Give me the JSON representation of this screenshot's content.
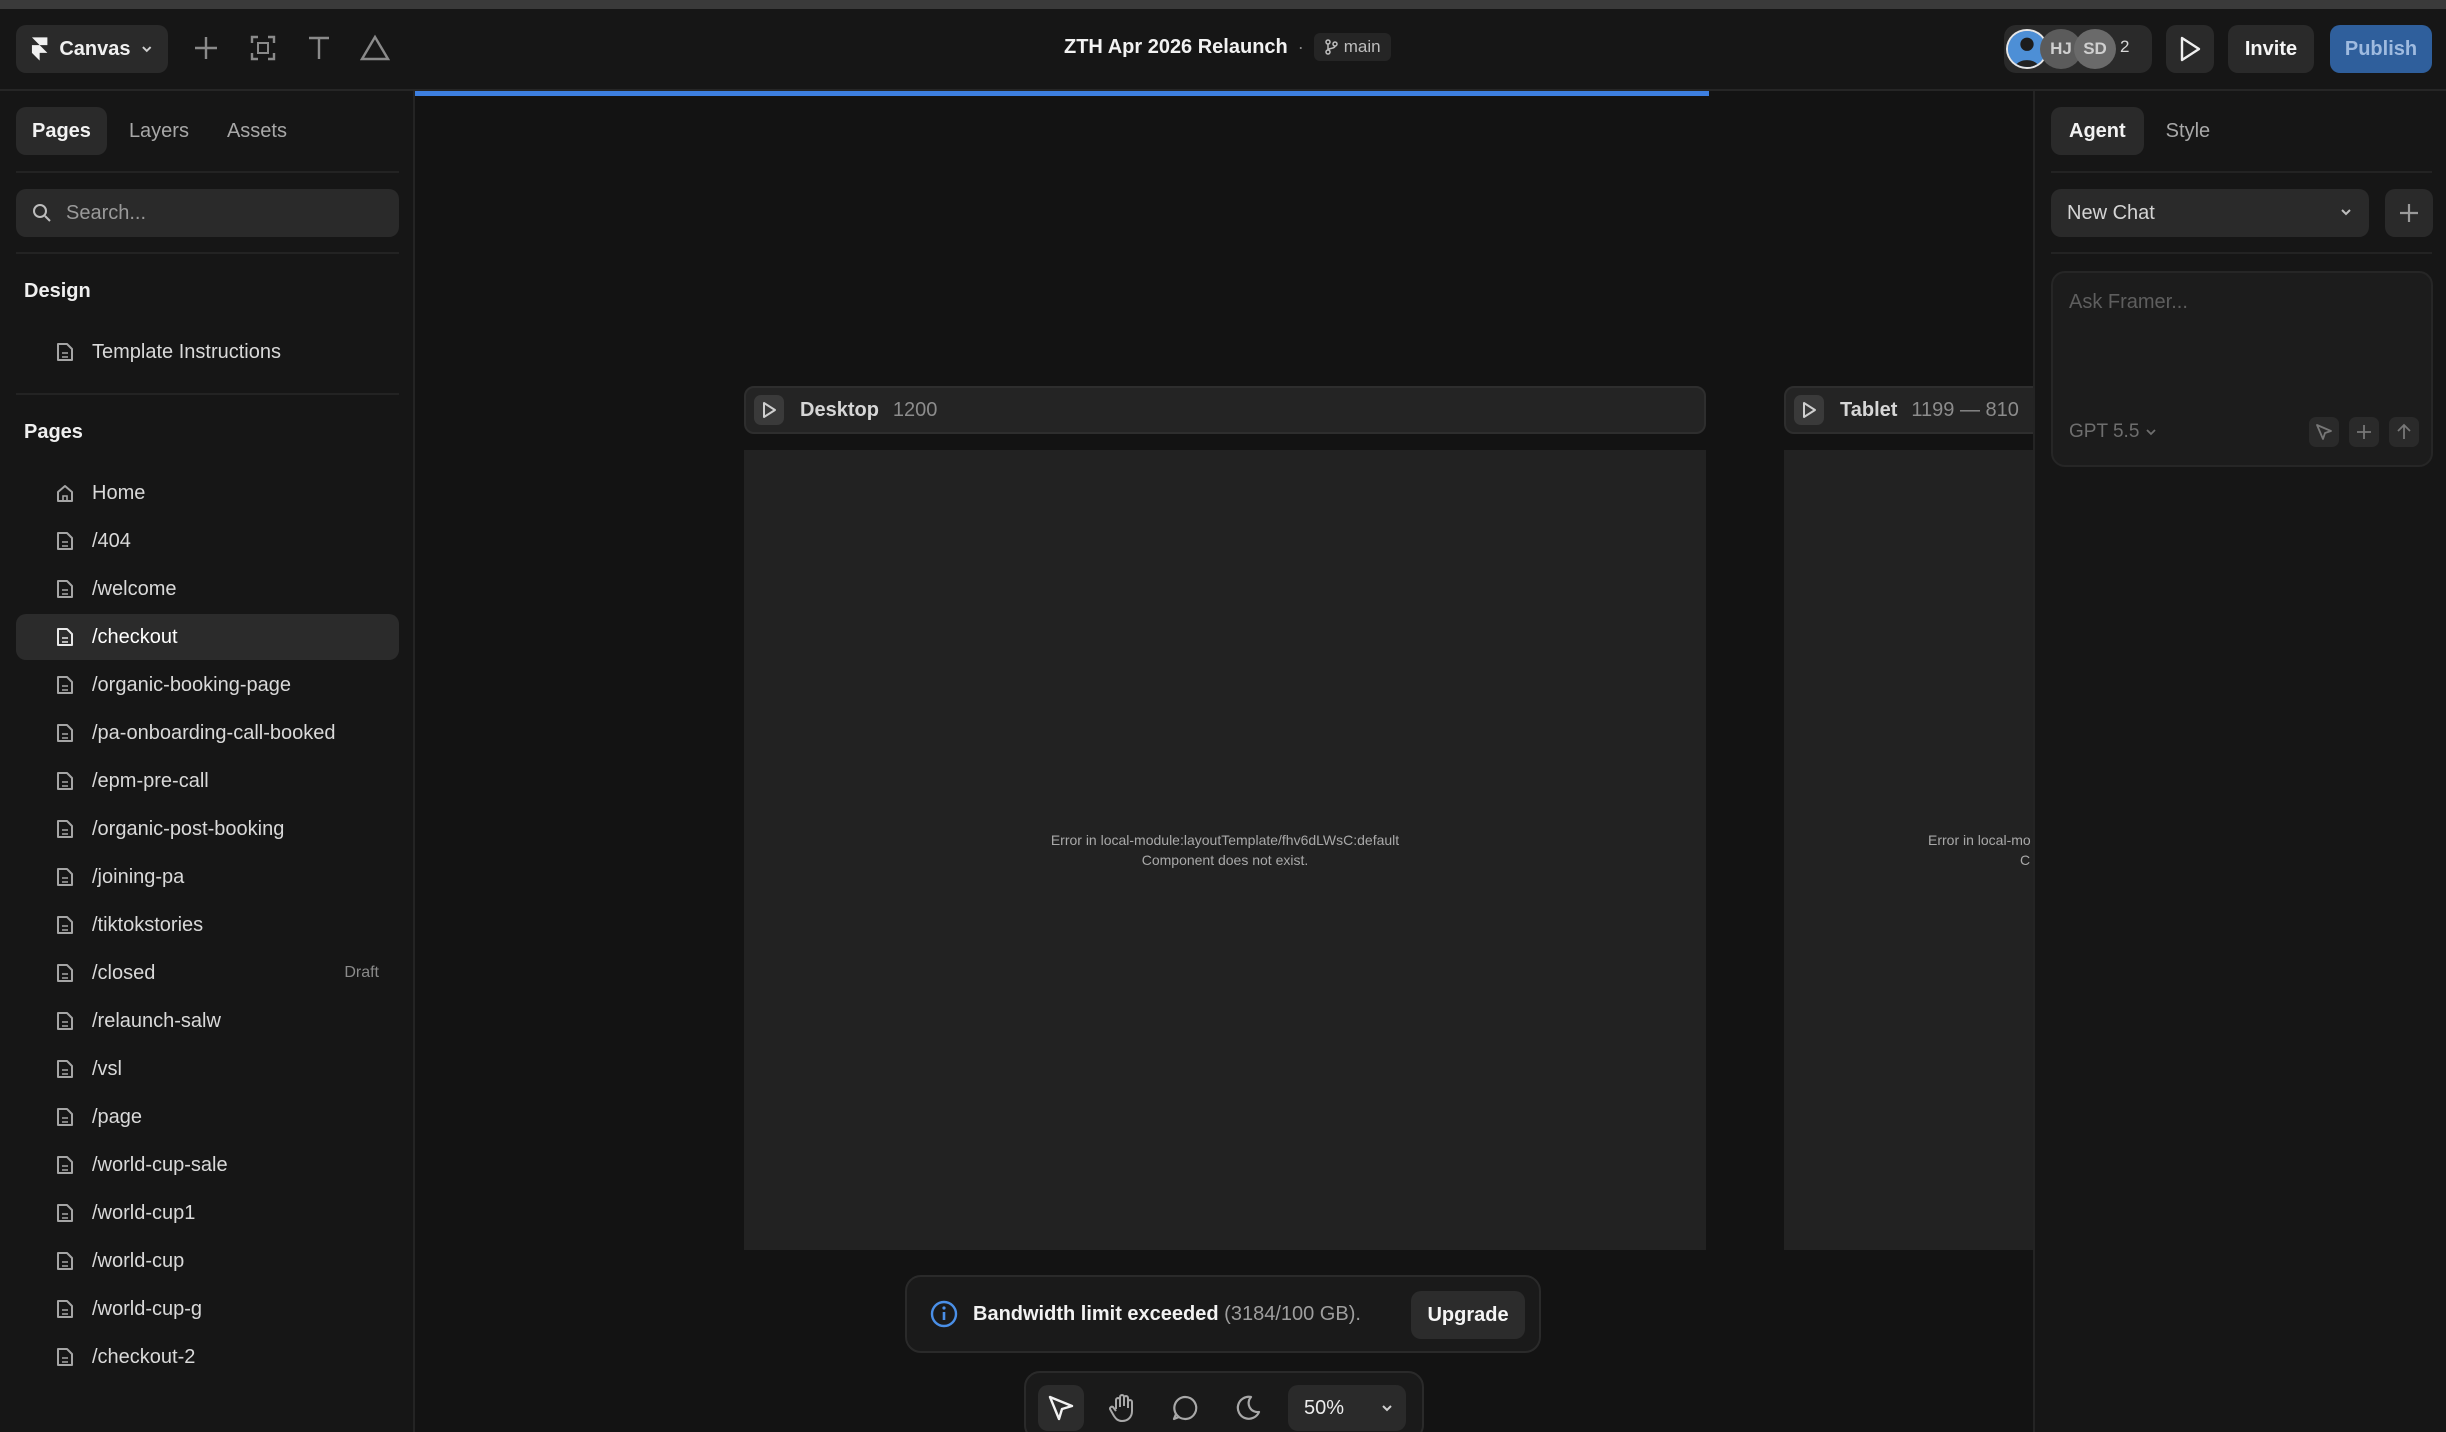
{
  "app": {
    "name": "Canvas"
  },
  "document": {
    "title": "ZTH Apr 2026 Relaunch",
    "separator": "·",
    "branch": "main"
  },
  "collaborators": {
    "initials": [
      "HJ",
      "SD"
    ],
    "count": "2"
  },
  "header": {
    "invite_label": "Invite",
    "publish_label": "Publish"
  },
  "left_panel": {
    "tabs": [
      "Pages",
      "Layers",
      "Assets"
    ],
    "search_placeholder": "Search...",
    "design_section": {
      "title": "Design",
      "items": [
        "Template Instructions"
      ]
    },
    "pages_section": {
      "title": "Pages",
      "items": [
        {
          "label": "Home",
          "icon": "home-icon"
        },
        {
          "label": "/404",
          "icon": "page-icon"
        },
        {
          "label": "/welcome",
          "icon": "page-icon"
        },
        {
          "label": "/checkout",
          "icon": "page-icon",
          "selected": true
        },
        {
          "label": "/organic-booking-page",
          "icon": "page-icon"
        },
        {
          "label": "/pa-onboarding-call-booked",
          "icon": "page-icon"
        },
        {
          "label": "/epm-pre-call",
          "icon": "page-icon"
        },
        {
          "label": "/organic-post-booking",
          "icon": "page-icon"
        },
        {
          "label": "/joining-pa",
          "icon": "page-icon"
        },
        {
          "label": "/tiktokstories",
          "icon": "page-icon"
        },
        {
          "label": "/closed",
          "icon": "page-icon",
          "badge": "Draft"
        },
        {
          "label": "/relaunch-salw",
          "icon": "page-icon"
        },
        {
          "label": "/vsl",
          "icon": "page-icon"
        },
        {
          "label": "/page",
          "icon": "page-icon"
        },
        {
          "label": "/world-cup-sale",
          "icon": "page-icon"
        },
        {
          "label": "/world-cup1",
          "icon": "page-icon"
        },
        {
          "label": "/world-cup",
          "icon": "page-icon"
        },
        {
          "label": "/world-cup-g",
          "icon": "page-icon"
        },
        {
          "label": "/checkout-2",
          "icon": "page-icon"
        }
      ]
    }
  },
  "canvas": {
    "progress_fraction": 0.8,
    "frames": [
      {
        "name": "Desktop",
        "size": "1200",
        "error_line1": "Error in local-module:layoutTemplate/fhv6dLWsC:default",
        "error_line2": "Component does not exist."
      },
      {
        "name": "Tablet",
        "size": "1199 — 810",
        "error_line1": "Error in local-mo",
        "error_line2": "C"
      }
    ],
    "toast": {
      "title": "Bandwidth limit exceeded",
      "detail": "(3184/100 GB).",
      "action": "Upgrade"
    },
    "zoom": "50%"
  },
  "right_panel": {
    "tabs": [
      "Agent",
      "Style"
    ],
    "chat_select": "New Chat",
    "ask_placeholder": "Ask Framer...",
    "model": "GPT 5.5"
  },
  "colors": {
    "accent": "#3d7fe0",
    "publish": "#2f5f9c",
    "info": "#4a8fe7"
  }
}
